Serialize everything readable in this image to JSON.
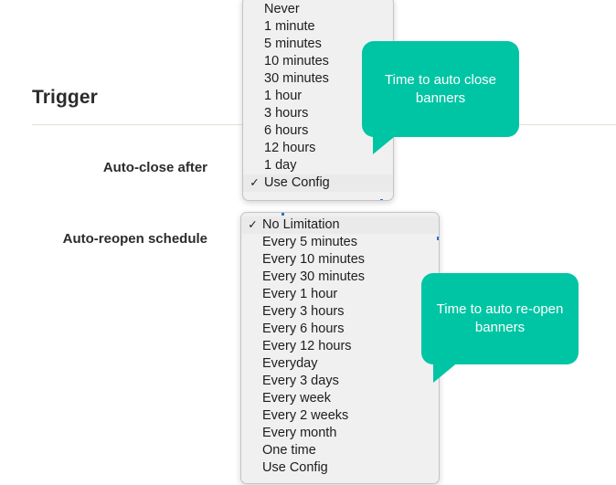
{
  "section": {
    "title": "Trigger"
  },
  "fields": [
    {
      "label": "Auto-close after"
    },
    {
      "label": "Auto-reopen schedule"
    }
  ],
  "dropdowns": {
    "auto_close_after": {
      "name": "auto-close-after-dropdown",
      "selected": "Use Config",
      "options": [
        "Never",
        "1 minute",
        "5 minutes",
        "10 minutes",
        "30 minutes",
        "1 hour",
        "3 hours",
        "6 hours",
        "12 hours",
        "1 day",
        "Use Config"
      ]
    },
    "auto_reopen_schedule": {
      "name": "auto-reopen-schedule-dropdown",
      "selected": "No Limitation",
      "options": [
        "No Limitation",
        "Every 5 minutes",
        "Every 10 minutes",
        "Every 30 minutes",
        "Every 1 hour",
        "Every 3 hours",
        "Every 6 hours",
        "Every 12 hours",
        "Everyday",
        "Every 3 days",
        "Every week",
        "Every 2 weeks",
        "Every month",
        "One time",
        "Use Config"
      ]
    }
  },
  "checkmark_glyph": "✓",
  "callouts": [
    {
      "text": "Time to auto close banners"
    },
    {
      "text": "Time to auto re-open banners"
    }
  ],
  "colors": {
    "callout_teal": "#00c5a4",
    "rule": "#e3ded3",
    "popup_bg": "#f0f0f0",
    "popup_border": "#c4c4c4",
    "selected_row": "#eaeaea",
    "text": "#1d1d1d",
    "focus_accent": "#2f6fd0"
  }
}
